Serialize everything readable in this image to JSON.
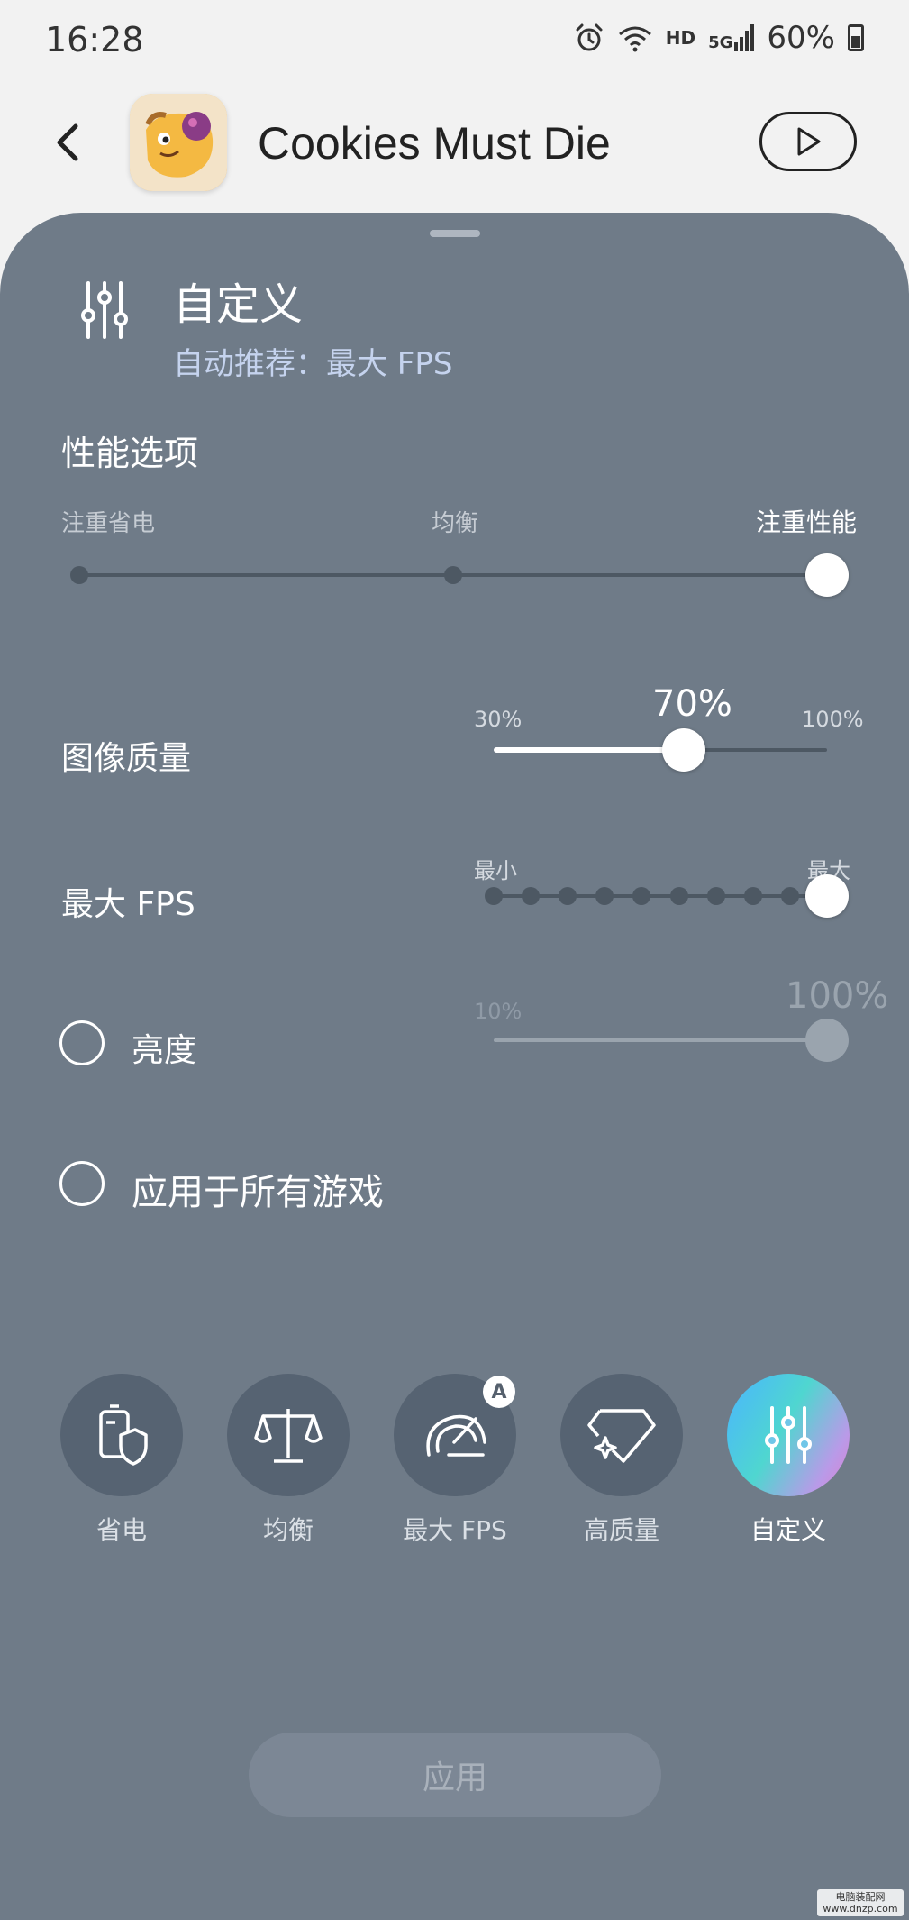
{
  "status_bar": {
    "time": "16:28",
    "network": "HD",
    "signal": "5G",
    "battery": "60%"
  },
  "header": {
    "app_name": "Cookies Must Die"
  },
  "mode": {
    "title": "自定义",
    "subtitle": "自动推荐：最大 FPS"
  },
  "performance": {
    "title": "性能选项",
    "options": [
      "注重省电",
      "均衡",
      "注重性能"
    ],
    "selected_index": 2
  },
  "image_quality": {
    "label": "图像质量",
    "min": "30%",
    "max": "100%",
    "value": "70%",
    "fraction": 0.57
  },
  "max_fps": {
    "label": "最大 FPS",
    "min": "最小",
    "max": "最大",
    "steps": 10,
    "selected_step": 9
  },
  "brightness": {
    "label": "亮度",
    "min": "10%",
    "value": "100%",
    "checked": false
  },
  "apply_all": {
    "label": "应用于所有游戏",
    "checked": false
  },
  "modes": [
    {
      "label": "省电",
      "icon": "battery-shield-icon"
    },
    {
      "label": "均衡",
      "icon": "balance-scale-icon"
    },
    {
      "label": "最大 FPS",
      "icon": "speedometer-icon",
      "badge": "A"
    },
    {
      "label": "高质量",
      "icon": "diamond-sparkle-icon"
    },
    {
      "label": "自定义",
      "icon": "sliders-icon"
    }
  ],
  "active_mode_index": 4,
  "apply_button": {
    "label": "应用"
  },
  "watermark": {
    "line1": "电脑装配网",
    "line2": "www.dnzp.com"
  }
}
